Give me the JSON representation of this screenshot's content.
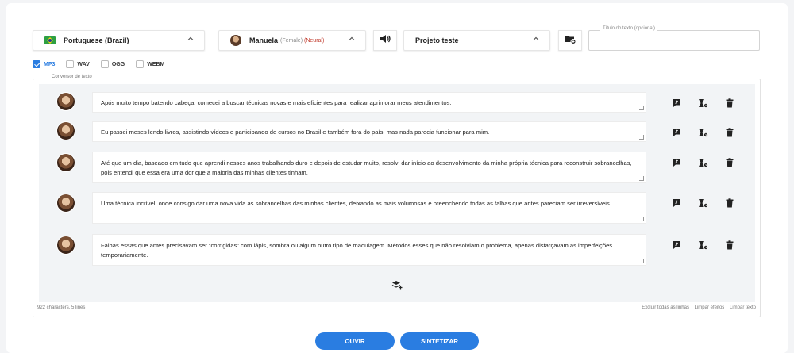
{
  "language": {
    "label": "Portuguese (Brazil)",
    "icon": "brazil-flag-icon"
  },
  "voice": {
    "name": "Manuela",
    "gender": "(Female)",
    "engine": "(Neural)"
  },
  "speaker_icon": "speaker-icon",
  "project": {
    "label": "Projeto teste"
  },
  "folder_icon": "folder-add-icon",
  "title_field": {
    "legend": "Título do texto (opcional)",
    "value": ""
  },
  "formats": [
    {
      "label": "MP3",
      "checked": true
    },
    {
      "label": "WAV",
      "checked": false
    },
    {
      "label": "OGG",
      "checked": false
    },
    {
      "label": "WEBM",
      "checked": false
    }
  ],
  "converter": {
    "legend": "Conversor de texto",
    "lines": [
      {
        "text": "Após muito tempo batendo cabeça, comecei a buscar técnicas novas e mais eficientes para realizar aprimorar meus atendimentos."
      },
      {
        "text": "Eu passei meses lendo livros, assistindo vídeos e participando de cursos no Brasil e também fora do país, mas nada parecia funcionar para mim."
      },
      {
        "text": "Até que um dia, baseado em tudo que aprendi nesses anos trabalhando duro e depois de estudar muito, resolvi dar início ao desenvolvimento da minha própria técnica para reconstruir sobrancelhas, pois entendi que essa era uma dor que a maioria das minhas clientes tinham."
      },
      {
        "text": "Uma técnica incrível, onde consigo dar uma nova vida as sobrancelhas das minhas clientes, deixando as mais volumosas e preenchendo todas as falhas que antes pareciam ser irreversíveis."
      },
      {
        "text": "Falhas essas que antes precisavam ser “corrigidas” com lápis, sombra ou algum outro tipo de maquiagem. Métodos esses que não resolviam o problema, apenas disfarçavam as imperfeições temporariamente."
      }
    ]
  },
  "status": "922 characters, 5 lines",
  "actions": {
    "clear_lines": "Excluir todas as linhas",
    "clear_effects": "Limpar efeitos",
    "clear_text": "Limpar texto"
  },
  "buttons": {
    "listen": "OUVIR",
    "synthesize": "SINTETIZAR"
  },
  "colors": {
    "accent": "#2a7de1",
    "neural": "#c0392b",
    "panel_bg": "#f2f4f6"
  }
}
